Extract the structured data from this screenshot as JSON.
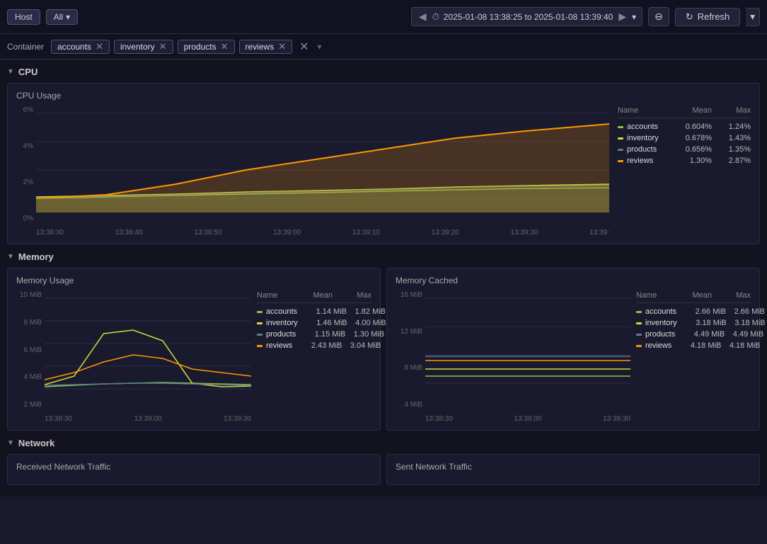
{
  "topbar": {
    "host_label": "Host",
    "all_label": "All",
    "time_range": "2025-01-08 13:38:25 to 2025-01-08 13:39:40",
    "refresh_label": "Refresh"
  },
  "filters": {
    "container_label": "Container",
    "tags": [
      "accounts",
      "inventory",
      "products",
      "reviews"
    ]
  },
  "sections": {
    "cpu": {
      "label": "CPU",
      "panels": [
        {
          "title": "CPU Usage",
          "y_labels": [
            "6%",
            "4%",
            "2%",
            "0%"
          ],
          "x_labels": [
            "13:38:30",
            "13:38:40",
            "13:38:50",
            "13:39:00",
            "13:39:10",
            "13:39:20",
            "13:39:30",
            "13:39:"
          ],
          "legend": {
            "headers": [
              "Name",
              "Mean",
              "Max"
            ],
            "rows": [
              {
                "name": "accounts",
                "color": "#8bc34a",
                "mean": "0.604%",
                "max": "1.24%"
              },
              {
                "name": "inventory",
                "color": "#cddc39",
                "mean": "0.678%",
                "max": "1.43%"
              },
              {
                "name": "products",
                "color": "#607d8b",
                "mean": "0.656%",
                "max": "1.35%"
              },
              {
                "name": "reviews",
                "color": "#ff9800",
                "mean": "1.30%",
                "max": "2.87%"
              }
            ]
          }
        }
      ]
    },
    "memory": {
      "label": "Memory",
      "panels": [
        {
          "title": "Memory Usage",
          "y_labels": [
            "10 MiB",
            "8 MiB",
            "6 MiB",
            "4 MiB",
            "2 MiB"
          ],
          "x_labels": [
            "13:38:30",
            "13:39:00",
            "13:39:30"
          ],
          "legend": {
            "headers": [
              "Name",
              "Mean",
              "Max"
            ],
            "rows": [
              {
                "name": "accounts",
                "color": "#8bc34a",
                "mean": "1.14 MiB",
                "max": "1.82 MiB"
              },
              {
                "name": "inventory",
                "color": "#cddc39",
                "mean": "1.46 MiB",
                "max": "4.00 MiB"
              },
              {
                "name": "products",
                "color": "#607d8b",
                "mean": "1.15 MiB",
                "max": "1.30 MiB"
              },
              {
                "name": "reviews",
                "color": "#ff9800",
                "mean": "2.43 MiB",
                "max": "3.04 MiB"
              }
            ]
          }
        },
        {
          "title": "Memory Cached",
          "y_labels": [
            "16 MiB",
            "12 MiB",
            "8 MiB",
            "4 MiB"
          ],
          "x_labels": [
            "13:38:30",
            "13:39:00",
            "13:39:30"
          ],
          "legend": {
            "headers": [
              "Name",
              "Mean",
              "Max"
            ],
            "rows": [
              {
                "name": "accounts",
                "color": "#8bc34a",
                "mean": "2.66 MiB",
                "max": "2.66 MiB"
              },
              {
                "name": "inventory",
                "color": "#cddc39",
                "mean": "3.18 MiB",
                "max": "3.18 MiB"
              },
              {
                "name": "products",
                "color": "#607d8b",
                "mean": "4.49 MiB",
                "max": "4.49 MiB"
              },
              {
                "name": "reviews",
                "color": "#ff9800",
                "mean": "4.18 MiB",
                "max": "4.18 MiB"
              }
            ]
          }
        }
      ]
    },
    "network": {
      "label": "Network",
      "panels": [
        {
          "title": "Received Network Traffic"
        },
        {
          "title": "Sent Network Traffic"
        }
      ]
    }
  }
}
